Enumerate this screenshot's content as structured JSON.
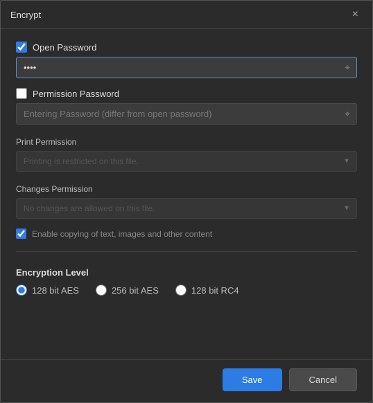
{
  "dialog": {
    "title": "Encrypt",
    "close_label": "×"
  },
  "open_password": {
    "checkbox_label": "Open Password",
    "checked": true,
    "input_value": "••••",
    "input_placeholder": "",
    "eye_icon": "👁"
  },
  "permission_password": {
    "checkbox_label": "Permission Password",
    "checked": false,
    "input_placeholder": "Entering Password (differ from open password)",
    "eye_icon": "👁"
  },
  "print_permission": {
    "label": "Print Permission",
    "value": "Printing is restricted on this file."
  },
  "changes_permission": {
    "label": "Changes Permission",
    "value": "No changes are allowed on this file."
  },
  "copy_content": {
    "label": "Enable copying of text, images and other content",
    "checked": true
  },
  "encryption_level": {
    "title": "Encryption Level",
    "options": [
      {
        "value": "128_aes",
        "label": "128 bit AES",
        "selected": true
      },
      {
        "value": "256_aes",
        "label": "256 bit AES",
        "selected": false
      },
      {
        "value": "128_rc4",
        "label": "128 bit RC4",
        "selected": false
      }
    ]
  },
  "footer": {
    "save_label": "Save",
    "cancel_label": "Cancel"
  }
}
